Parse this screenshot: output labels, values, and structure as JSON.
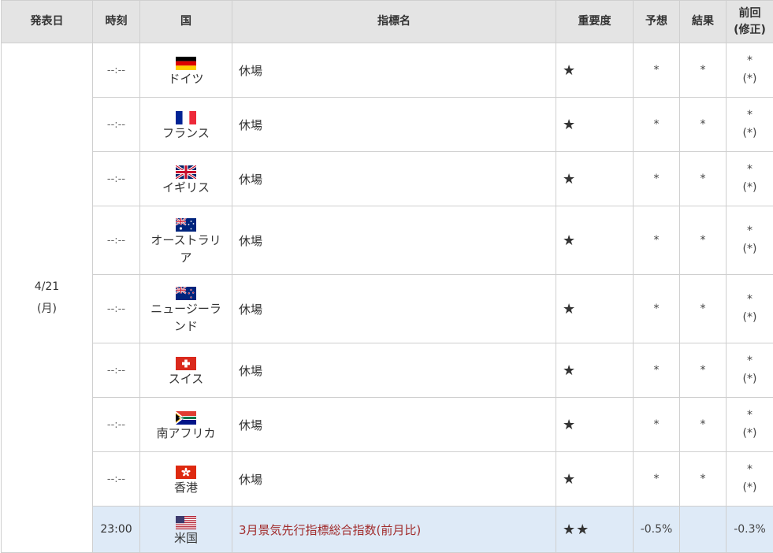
{
  "headers": {
    "date": "発表日",
    "time": "時刻",
    "country": "国",
    "indicator": "指標名",
    "importance": "重要度",
    "forecast": "予想",
    "result": "結果",
    "previous_line1": "前回",
    "previous_line2": "(修正)"
  },
  "date_cell": {
    "date": "4/21",
    "weekday": "(月)"
  },
  "rows": [
    {
      "time": "--:--",
      "country_line1": "ドイツ",
      "country_line2": "",
      "flag_icon": "germany-flag-icon",
      "indicator": "休場",
      "importance": "★",
      "forecast": "*",
      "result": "*",
      "prev_line1": "*",
      "prev_line2": "(*)"
    },
    {
      "time": "--:--",
      "country_line1": "フランス",
      "country_line2": "",
      "flag_icon": "france-flag-icon",
      "indicator": "休場",
      "importance": "★",
      "forecast": "*",
      "result": "*",
      "prev_line1": "*",
      "prev_line2": "(*)"
    },
    {
      "time": "--:--",
      "country_line1": "イギリス",
      "country_line2": "",
      "flag_icon": "uk-flag-icon",
      "indicator": "休場",
      "importance": "★",
      "forecast": "*",
      "result": "*",
      "prev_line1": "*",
      "prev_line2": "(*)"
    },
    {
      "time": "--:--",
      "country_line1": "オーストラリ",
      "country_line2": "ア",
      "flag_icon": "australia-flag-icon",
      "indicator": "休場",
      "importance": "★",
      "forecast": "*",
      "result": "*",
      "prev_line1": "*",
      "prev_line2": "(*)"
    },
    {
      "time": "--:--",
      "country_line1": "ニュージーラ",
      "country_line2": "ンド",
      "flag_icon": "new-zealand-flag-icon",
      "indicator": "休場",
      "importance": "★",
      "forecast": "*",
      "result": "*",
      "prev_line1": "*",
      "prev_line2": "(*)"
    },
    {
      "time": "--:--",
      "country_line1": "スイス",
      "country_line2": "",
      "flag_icon": "switzerland-flag-icon",
      "indicator": "休場",
      "importance": "★",
      "forecast": "*",
      "result": "*",
      "prev_line1": "*",
      "prev_line2": "(*)"
    },
    {
      "time": "--:--",
      "country_line1": "南アフリカ",
      "country_line2": "",
      "flag_icon": "south-africa-flag-icon",
      "indicator": "休場",
      "importance": "★",
      "forecast": "*",
      "result": "*",
      "prev_line1": "*",
      "prev_line2": "(*)"
    },
    {
      "time": "--:--",
      "country_line1": "香港",
      "country_line2": "",
      "flag_icon": "hong-kong-flag-icon",
      "indicator": "休場",
      "importance": "★",
      "forecast": "*",
      "result": "*",
      "prev_line1": "*",
      "prev_line2": "(*)"
    },
    {
      "time": "23:00",
      "country_line1": "米国",
      "country_line2": "",
      "flag_icon": "us-flag-icon",
      "indicator": "3月景気先行指標総合指数(前月比)",
      "importance": "★★",
      "forecast": "-0.5%",
      "result": "",
      "prev_line1": "-0.3%",
      "prev_line2": ""
    }
  ],
  "colors": {
    "header_bg": "#e4e4e4",
    "border": "#cfcfcf",
    "highlight_row_bg": "#deeaf7",
    "highlight_indicator_text": "#a12c2c"
  }
}
